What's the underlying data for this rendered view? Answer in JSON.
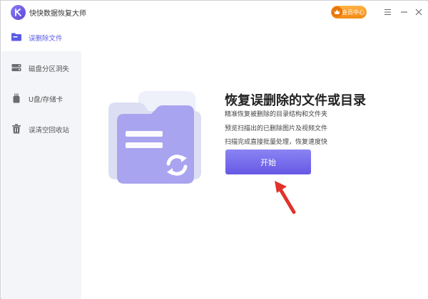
{
  "app": {
    "title": "快快数据恢复大师",
    "member_badge": "会员中心"
  },
  "sidebar": {
    "items": [
      {
        "label": "误删除文件",
        "icon": "folder-icon",
        "active": true
      },
      {
        "label": "磁盘分区洞失",
        "icon": "hard-disk-icon",
        "active": false
      },
      {
        "label": "U盘/存储卡",
        "icon": "usb-drive-icon",
        "active": false
      },
      {
        "label": "误清空回收站",
        "icon": "trash-icon",
        "active": false
      }
    ]
  },
  "main": {
    "headline": "恢复误删除的文件或目录",
    "desc_lines": [
      "精准恢复被删除的目录结构和文件夹",
      "预览扫描出的已删除图片及视频文件",
      "扫描完成直接批量处理，恢复速度快"
    ],
    "start_button": "开始"
  },
  "colors": {
    "accent": "#6658e4",
    "badge": "#f28a12",
    "sidebar_bg": "#f4f5f8",
    "arrow": "#e0332c"
  }
}
